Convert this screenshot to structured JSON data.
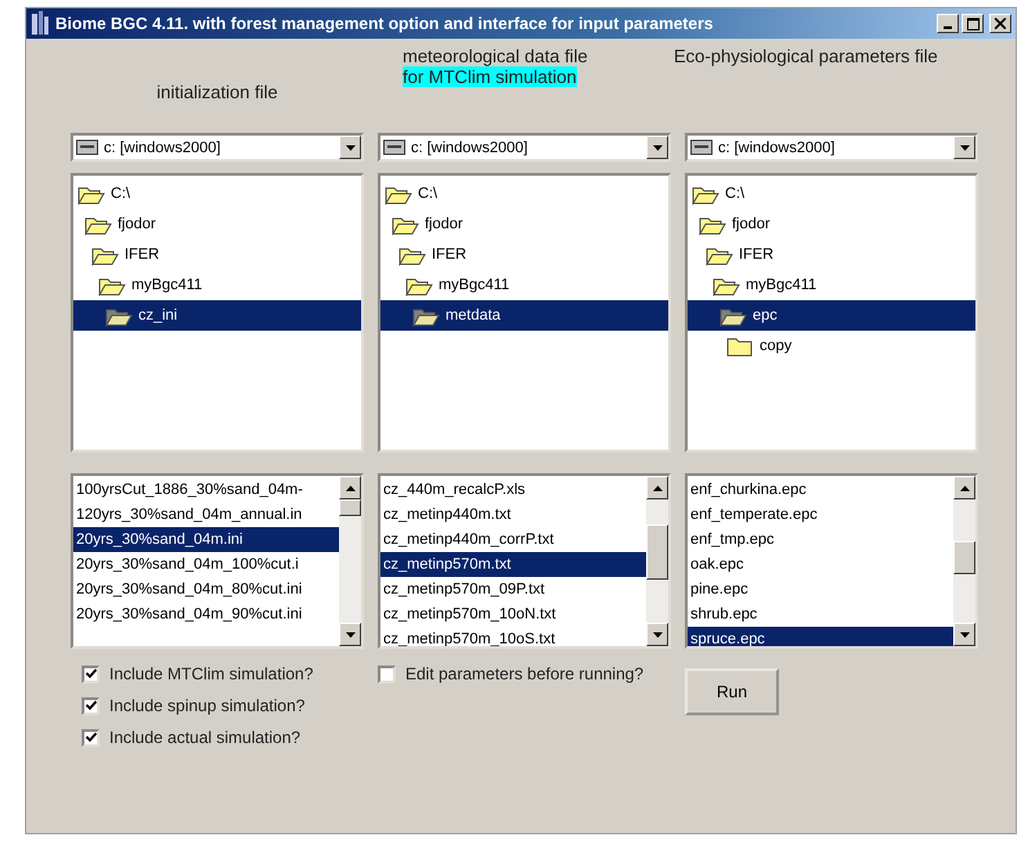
{
  "window": {
    "title": "Biome BGC 4.11. with forest management option and interface for input parameters"
  },
  "columns": [
    {
      "header": [
        {
          "text": "initialization file",
          "highlight": false
        }
      ],
      "drive": {
        "value": "c: [windows2000]"
      },
      "folders": [
        {
          "name": "C:\\",
          "selected": false,
          "children": [
            {
              "name": "fjodor",
              "selected": false,
              "children": [
                {
                  "name": "IFER",
                  "selected": false,
                  "children": [
                    {
                      "name": "myBgc411",
                      "selected": false,
                      "children": [
                        {
                          "name": "cz_ini",
                          "selected": true
                        }
                      ]
                    }
                  ]
                }
              ]
            }
          ]
        }
      ],
      "files": [
        {
          "name": "100yrsCut_1886_30%sand_04m-",
          "selected": false
        },
        {
          "name": "120yrs_30%sand_04m_annual.in",
          "selected": false
        },
        {
          "name": "20yrs_30%sand_04m.ini",
          "selected": true
        },
        {
          "name": "20yrs_30%sand_04m_100%cut.i",
          "selected": false
        },
        {
          "name": "20yrs_30%sand_04m_80%cut.ini",
          "selected": false
        },
        {
          "name": "20yrs_30%sand_04m_90%cut.ini",
          "selected": false
        }
      ],
      "controls": [
        {
          "kind": "checkbox",
          "label": "Include MTClim simulation?",
          "checked": true
        },
        {
          "kind": "checkbox",
          "label": "Include spinup simulation?",
          "checked": true
        },
        {
          "kind": "checkbox",
          "label": "Include actual simulation?",
          "checked": true
        }
      ]
    },
    {
      "header": [
        {
          "text": "meteorological data file",
          "highlight": false
        },
        {
          "text": "for MTClim simulation",
          "highlight": true
        }
      ],
      "drive": {
        "value": "c: [windows2000]"
      },
      "folders": [
        {
          "name": "C:\\",
          "selected": false,
          "children": [
            {
              "name": "fjodor",
              "selected": false,
              "children": [
                {
                  "name": "IFER",
                  "selected": false,
                  "children": [
                    {
                      "name": "myBgc411",
                      "selected": false,
                      "children": [
                        {
                          "name": "metdata",
                          "selected": true
                        }
                      ]
                    }
                  ]
                }
              ]
            }
          ]
        }
      ],
      "files": [
        {
          "name": "cz_440m_recalcP.xls",
          "selected": false
        },
        {
          "name": "cz_metinp440m.txt",
          "selected": false
        },
        {
          "name": "cz_metinp440m_corrP.txt",
          "selected": false
        },
        {
          "name": "cz_metinp570m.txt",
          "selected": true
        },
        {
          "name": "cz_metinp570m_09P.txt",
          "selected": false
        },
        {
          "name": "cz_metinp570m_10oN.txt",
          "selected": false
        },
        {
          "name": "cz_metinp570m_10oS.txt",
          "selected": false
        }
      ],
      "controls": [
        {
          "kind": "checkbox",
          "label": "Edit parameters before running?",
          "checked": false
        }
      ]
    },
    {
      "header": [
        {
          "text": "Eco-physiological parameters file",
          "highlight": false
        }
      ],
      "drive": {
        "value": "c: [windows2000]"
      },
      "folders": [
        {
          "name": "C:\\",
          "selected": false,
          "children": [
            {
              "name": "fjodor",
              "selected": false,
              "children": [
                {
                  "name": "IFER",
                  "selected": false,
                  "children": [
                    {
                      "name": "myBgc411",
                      "selected": false,
                      "children": [
                        {
                          "name": "epc",
                          "selected": true,
                          "children": [
                            {
                              "name": "copy",
                              "selected": false
                            }
                          ]
                        }
                      ]
                    }
                  ]
                }
              ]
            }
          ]
        }
      ],
      "files": [
        {
          "name": "enf_churkina.epc",
          "selected": false
        },
        {
          "name": "enf_temperate.epc",
          "selected": false
        },
        {
          "name": "enf_tmp.epc",
          "selected": false
        },
        {
          "name": "oak.epc",
          "selected": false
        },
        {
          "name": "pine.epc",
          "selected": false
        },
        {
          "name": "shrub.epc",
          "selected": false
        },
        {
          "name": "spruce.epc",
          "selected": true
        }
      ],
      "controls": [
        {
          "kind": "button",
          "label": "Run"
        }
      ]
    }
  ]
}
